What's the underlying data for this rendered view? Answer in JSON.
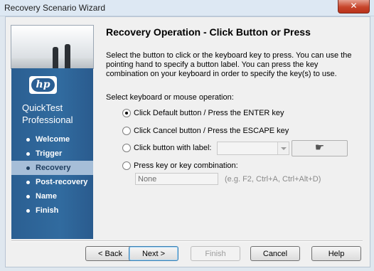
{
  "window": {
    "title": "Recovery Scenario Wizard",
    "close_glyph": "✕"
  },
  "sidebar": {
    "logo_text": "hp",
    "product_line1": "QuickTest",
    "product_line2": "Professional",
    "steps": [
      {
        "label": "Welcome",
        "active": false
      },
      {
        "label": "Trigger",
        "active": false
      },
      {
        "label": "Recovery",
        "active": true
      },
      {
        "label": "Post-recovery",
        "active": false
      },
      {
        "label": "Name",
        "active": false
      },
      {
        "label": "Finish",
        "active": false
      }
    ]
  },
  "main": {
    "heading": "Recovery Operation - Click Button or Press",
    "description": "Select the button to click or the keyboard key to press. You can use the pointing hand to specify a button label. You can press the key combination on your keyboard in order to specify the key(s) to use.",
    "select_label": "Select keyboard or mouse operation:",
    "options": [
      {
        "label": "Click Default button / Press the ENTER key",
        "selected": true
      },
      {
        "label": "Click Cancel button / Press the ESCAPE key",
        "selected": false
      },
      {
        "label": "Click button with label:",
        "selected": false
      },
      {
        "label": "Press key or key combination:",
        "selected": false
      }
    ],
    "button_label_value": "",
    "pointing_hand_icon": "☛",
    "key_value": "None",
    "key_hint": "(e.g. F2, Ctrl+A, Ctrl+Alt+D)"
  },
  "footer": {
    "back": "< Back",
    "next": "Next >",
    "finish": "Finish",
    "cancel": "Cancel",
    "help": "Help"
  }
}
